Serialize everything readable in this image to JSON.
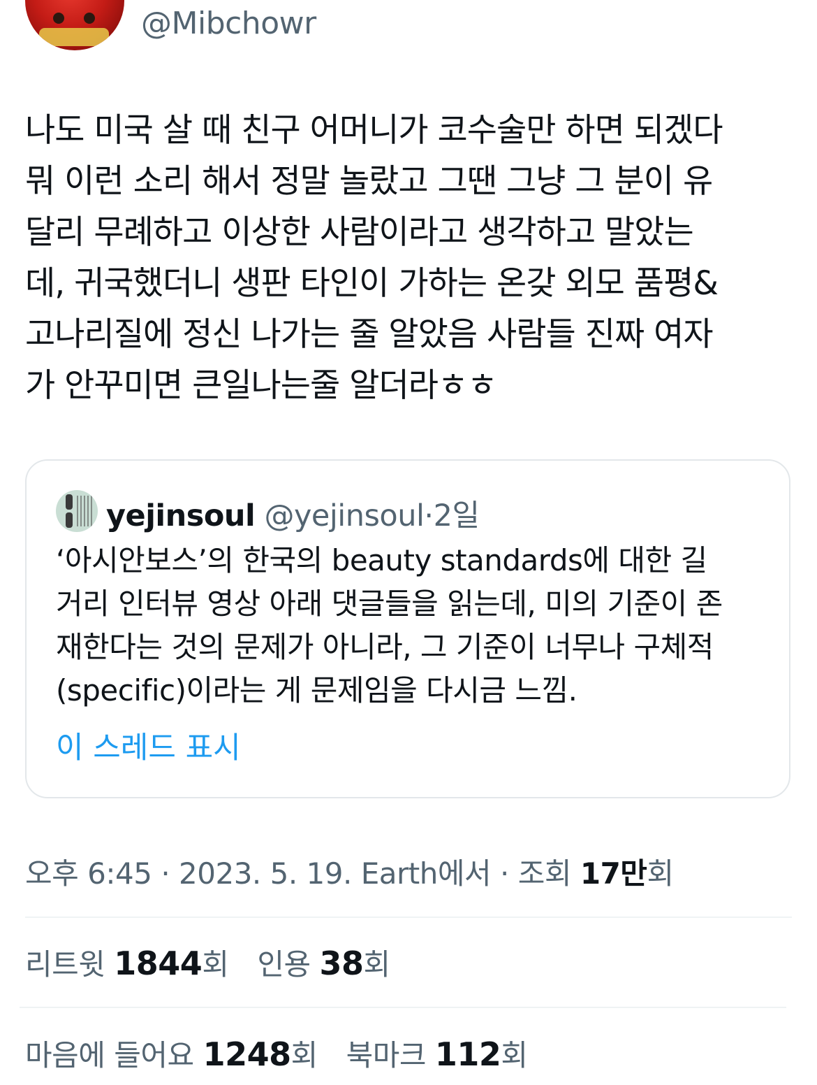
{
  "author": {
    "handle": "@Mibchowr",
    "avatar_icon": "user-avatar-icon"
  },
  "tweet": {
    "text": "나도 미국 살 때 친구 어머니가 코수술만 하면 되겠다\n뭐 이런 소리 해서 정말 놀랐고 그땐 그냥 그 분이 유\n달리 무례하고 이상한 사람이라고 생각하고 말았는\n데, 귀국했더니 생판 타인이 가하는 온갖 외모 품평&\n고나리질에 정신 나가는 줄 알았음 사람들 진짜 여자\n가 안꾸미면 큰일나는줄 알더라ㅎㅎ"
  },
  "quoted_tweet": {
    "name": "yejinsoul",
    "handle": "@yejinsoul",
    "separator": "·",
    "time": "2일",
    "text": "‘아시안보스’의 한국의 beauty standards에 대한 길\n거리 인터뷰 영상 아래 댓글들을 읽는데, 미의 기준이 존\n재한다는 것의 문제가 아니라, 그 기준이 너무나 구체적\n(specific)이라는 게 문제임을 다시금 느낌.",
    "show_thread_label": "이 스레드 표시"
  },
  "meta": {
    "time": "오후 6:45",
    "sep1": "·",
    "date": "2023. 5. 19.",
    "source": "Earth에서",
    "sep2": "·",
    "views_label": "조회",
    "views_value": "17만",
    "views_suffix": "회"
  },
  "stats": {
    "retweets_label": "리트윗",
    "retweets_value": "1844",
    "retweets_suffix": "회",
    "quotes_label": "인용",
    "quotes_value": "38",
    "quotes_suffix": "회",
    "likes_label": "마음에 들어요",
    "likes_value": "1248",
    "likes_suffix": "회",
    "bookmarks_label": "북마크",
    "bookmarks_value": "112",
    "bookmarks_suffix": "회"
  }
}
